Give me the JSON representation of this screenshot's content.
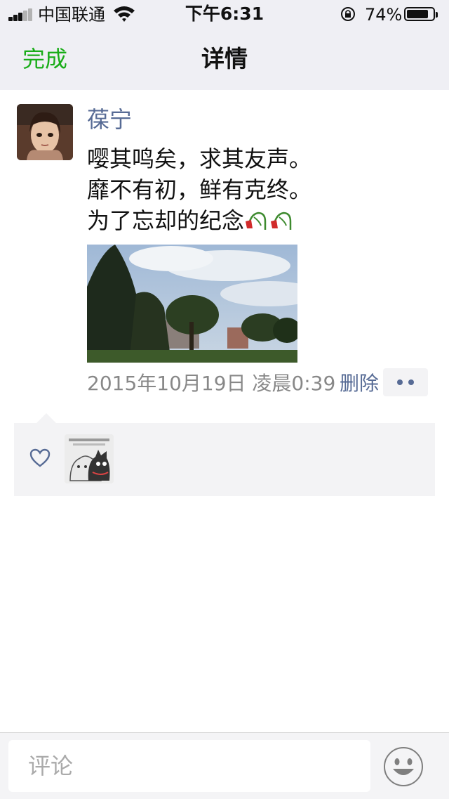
{
  "status_bar": {
    "carrier": "中国联通",
    "time": "下午6:31",
    "battery_percent_text": "74%",
    "battery_level": 0.74,
    "signal_bars": 5,
    "signal_bars_active": 3
  },
  "nav": {
    "done_label": "完成",
    "title": "详情"
  },
  "post": {
    "author": "葆宁",
    "lines": [
      "嘤其鸣矣，求其友声。",
      "靡不有初，鲜有克终。",
      "为了忘却的纪念"
    ],
    "emoji": "wilted-tulip-icon",
    "date": "2015年10月19日 凌晨0:39",
    "delete_label": "删除"
  },
  "colors": {
    "accent_green": "#1aad19",
    "link_blue": "#576b95",
    "nav_bg": "#efeff4"
  },
  "comment_bar": {
    "placeholder": "评论"
  }
}
